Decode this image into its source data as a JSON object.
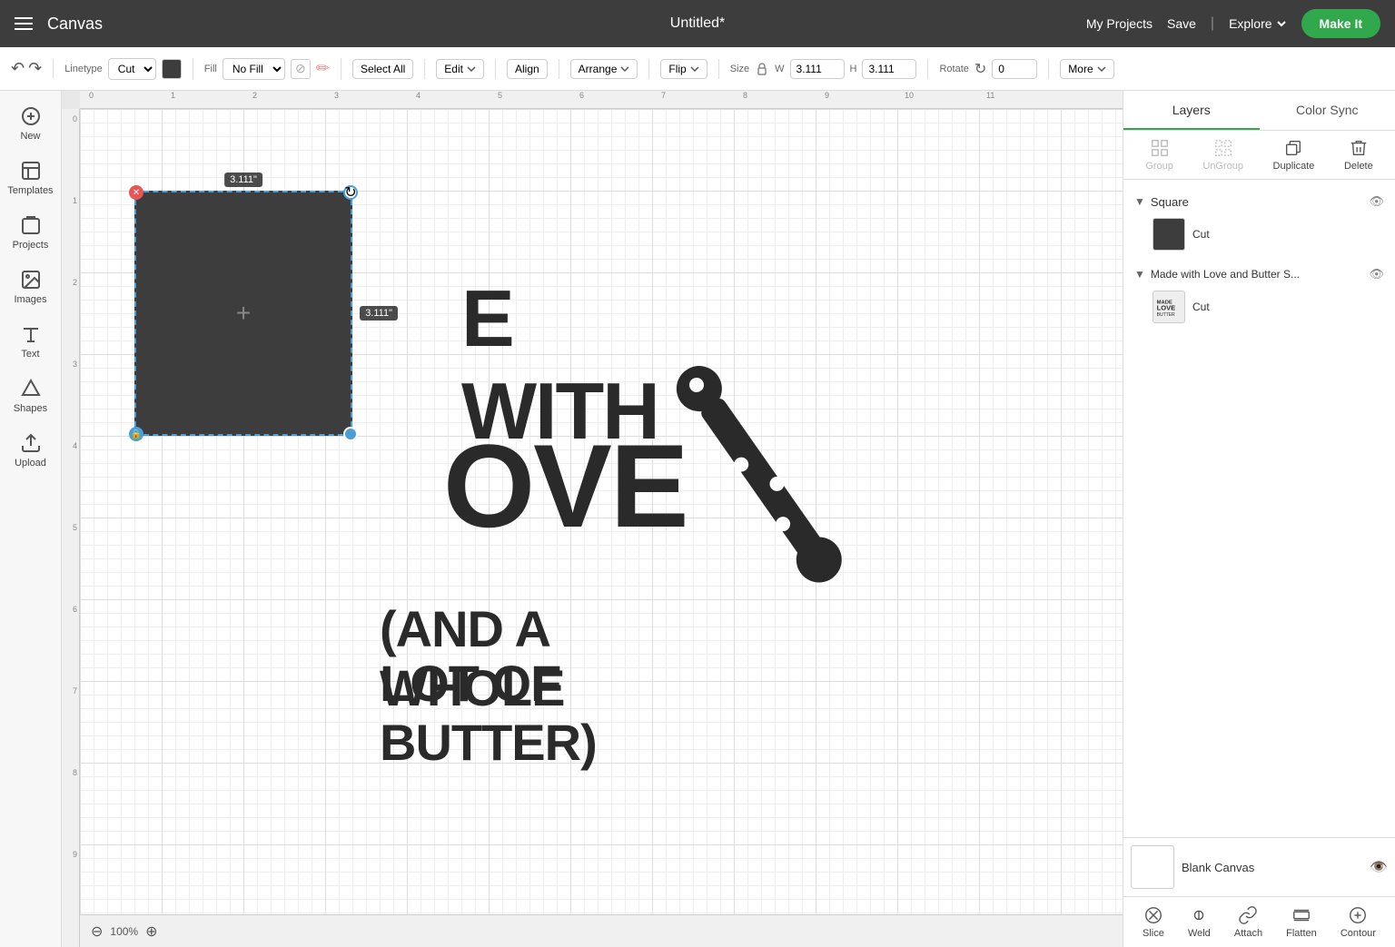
{
  "app": {
    "name": "Canvas",
    "doc_title": "Untitled*"
  },
  "topbar": {
    "my_projects": "My Projects",
    "save": "Save",
    "explore": "Explore",
    "make_it": "Make It"
  },
  "toolbar": {
    "undo": "↩",
    "redo": "↪",
    "linetype_label": "Linetype",
    "linetype_value": "Cut",
    "fill_label": "Fill",
    "fill_value": "No Fill",
    "select_all": "Select All",
    "edit": "Edit",
    "align": "Align",
    "arrange": "Arrange",
    "flip": "Flip",
    "size_label": "Size",
    "width_label": "W",
    "width_value": "3.111",
    "height_label": "H",
    "height_value": "3.111",
    "rotate_label": "Rotate",
    "rotate_value": "0",
    "more": "More"
  },
  "sidebar": {
    "items": [
      {
        "id": "new",
        "label": "New"
      },
      {
        "id": "templates",
        "label": "Templates"
      },
      {
        "id": "projects",
        "label": "Projects"
      },
      {
        "id": "images",
        "label": "Images"
      },
      {
        "id": "text",
        "label": "Text"
      },
      {
        "id": "shapes",
        "label": "Shapes"
      },
      {
        "id": "upload",
        "label": "Upload"
      }
    ]
  },
  "canvas": {
    "zoom": "100%",
    "dimension1": "3.111\"",
    "dimension2": "3.111\""
  },
  "layers_panel": {
    "layers_tab": "Layers",
    "color_sync_tab": "Color Sync",
    "group_label": "Group",
    "ungroup_label": "UnGroup",
    "duplicate_label": "Duplicate",
    "delete_label": "Delete",
    "layer1": {
      "name": "Square",
      "type": "Cut"
    },
    "layer2": {
      "name": "Made with Love and Butter S...",
      "type": "Cut"
    },
    "blank_canvas": "Blank Canvas"
  },
  "bottom_actions": {
    "slice": "Slice",
    "weld": "Weld",
    "attach": "Attach",
    "flatten": "Flatten",
    "contour": "Contour"
  },
  "design_text": {
    "line1": "E WITH",
    "line2": "OVE",
    "line3": "(AND A WHOLE",
    "line4": "LOT OF BUTTER)"
  }
}
